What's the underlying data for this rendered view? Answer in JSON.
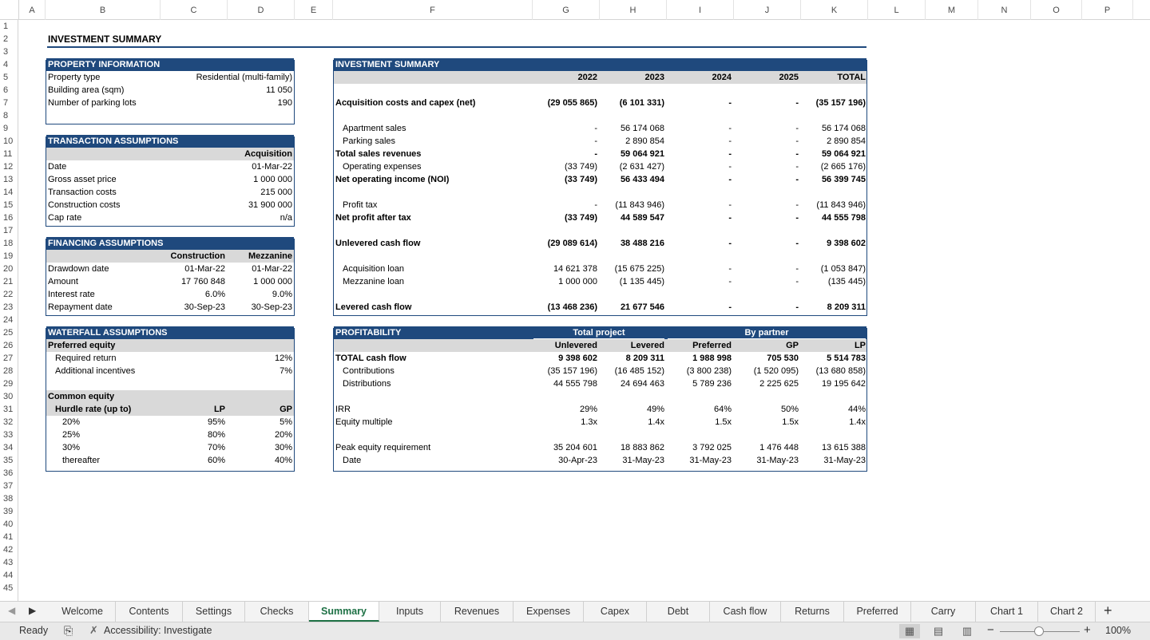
{
  "columns": [
    "A",
    "B",
    "C",
    "D",
    "E",
    "F",
    "G",
    "H",
    "I",
    "J",
    "K",
    "L",
    "M",
    "N",
    "O",
    "P"
  ],
  "rows": [
    "1",
    "2",
    "3",
    "4",
    "5",
    "6",
    "7",
    "8",
    "9",
    "10",
    "11",
    "12",
    "13",
    "14",
    "15",
    "16",
    "17",
    "18",
    "19",
    "20",
    "21",
    "22",
    "23",
    "24",
    "25",
    "26",
    "27",
    "28",
    "29",
    "30",
    "31",
    "32",
    "33",
    "34",
    "35",
    "36",
    "37",
    "38",
    "39",
    "40",
    "41",
    "42",
    "43",
    "44",
    "45"
  ],
  "title": "INVESTMENT SUMMARY",
  "property": {
    "header": "PROPERTY INFORMATION",
    "rows": [
      {
        "label": "Property type",
        "value": "Residential (multi-family)"
      },
      {
        "label": "Building area (sqm)",
        "value": "11 050"
      },
      {
        "label": "Number of parking lots",
        "value": "190"
      }
    ]
  },
  "transaction": {
    "header": "TRANSACTION ASSUMPTIONS",
    "col": "Acquisition",
    "rows": [
      {
        "label": "Date",
        "value": "01-Mar-22"
      },
      {
        "label": "Gross asset price",
        "value": "1 000 000"
      },
      {
        "label": "Transaction costs",
        "value": "215 000"
      },
      {
        "label": "Construction costs",
        "value": "31 900 000"
      },
      {
        "label": "Cap rate",
        "value": "n/a"
      }
    ]
  },
  "financing": {
    "header": "FINANCING ASSUMPTIONS",
    "cols": [
      "Construction",
      "Mezzanine"
    ],
    "rows": [
      {
        "label": "Drawdown date",
        "c": "01-Mar-22",
        "d": "01-Mar-22"
      },
      {
        "label": "Amount",
        "c": "17 760 848",
        "d": "1 000 000"
      },
      {
        "label": "Interest rate",
        "c": "6.0%",
        "d": "9.0%"
      },
      {
        "label": "Repayment date",
        "c": "30-Sep-23",
        "d": "30-Sep-23"
      }
    ]
  },
  "waterfall": {
    "header": "WATERFALL ASSUMPTIONS",
    "preferred_label": "Preferred equity",
    "required_return_label": "Required return",
    "required_return": "12%",
    "incentives_label": "Additional incentives",
    "incentives": "7%",
    "common_label": "Common equity",
    "hurdle_label": "Hurdle rate (up to)",
    "lp": "LP",
    "gp": "GP",
    "hurdles": [
      {
        "h": "20%",
        "lp": "95%",
        "gp": "5%"
      },
      {
        "h": "25%",
        "lp": "80%",
        "gp": "20%"
      },
      {
        "h": "30%",
        "lp": "70%",
        "gp": "30%"
      },
      {
        "h": "thereafter",
        "lp": "60%",
        "gp": "40%"
      }
    ]
  },
  "summary": {
    "header": "INVESTMENT SUMMARY",
    "years": [
      "2022",
      "2023",
      "2024",
      "2025",
      "TOTAL"
    ],
    "acq": {
      "label": "Acquisition costs and capex (net)",
      "v": [
        "(29 055 865)",
        "(6 101 331)",
        "-",
        "-",
        "(35 157 196)"
      ]
    },
    "apt": {
      "label": "Apartment sales",
      "v": [
        "-",
        "56 174 068",
        "-",
        "-",
        "56 174 068"
      ]
    },
    "park": {
      "label": "Parking sales",
      "v": [
        "-",
        "2 890 854",
        "-",
        "-",
        "2 890 854"
      ]
    },
    "tsr": {
      "label": "Total sales revenues",
      "v": [
        "-",
        "59 064 921",
        "-",
        "-",
        "59 064 921"
      ]
    },
    "opex": {
      "label": "Operating expenses",
      "v": [
        "(33 749)",
        "(2 631 427)",
        "-",
        "-",
        "(2 665 176)"
      ]
    },
    "noi": {
      "label": "Net operating income (NOI)",
      "v": [
        "(33 749)",
        "56 433 494",
        "-",
        "-",
        "56 399 745"
      ]
    },
    "tax": {
      "label": "Profit tax",
      "v": [
        "-",
        "(11 843 946)",
        "-",
        "-",
        "(11 843 946)"
      ]
    },
    "npat": {
      "label": "Net profit after tax",
      "v": [
        "(33 749)",
        "44 589 547",
        "-",
        "-",
        "44 555 798"
      ]
    },
    "ucf": {
      "label": "Unlevered cash flow",
      "v": [
        "(29 089 614)",
        "38 488 216",
        "-",
        "-",
        "9 398 602"
      ]
    },
    "aloan": {
      "label": "Acquisition loan",
      "v": [
        "14 621 378",
        "(15 675 225)",
        "-",
        "-",
        "(1 053 847)"
      ]
    },
    "mloan": {
      "label": "Mezzanine loan",
      "v": [
        "1 000 000",
        "(1 135 445)",
        "-",
        "-",
        "(135 445)"
      ]
    },
    "lcf": {
      "label": "Levered cash flow",
      "v": [
        "(13 468 236)",
        "21 677 546",
        "-",
        "-",
        "8 209 311"
      ]
    }
  },
  "profit": {
    "header": "PROFITABILITY",
    "group1": "Total project",
    "group2": "By partner",
    "cols": [
      "Unlevered",
      "Levered",
      "Preferred",
      "GP",
      "LP"
    ],
    "tcf": {
      "label": "TOTAL cash flow",
      "v": [
        "9 398 602",
        "8 209 311",
        "1 988 998",
        "705 530",
        "5 514 783"
      ]
    },
    "contrib": {
      "label": "Contributions",
      "v": [
        "(35 157 196)",
        "(16 485 152)",
        "(3 800 238)",
        "(1 520 095)",
        "(13 680 858)"
      ]
    },
    "dist": {
      "label": "Distributions",
      "v": [
        "44 555 798",
        "24 694 463",
        "5 789 236",
        "2 225 625",
        "19 195 642"
      ]
    },
    "irr": {
      "label": "IRR",
      "v": [
        "29%",
        "49%",
        "64%",
        "50%",
        "44%"
      ]
    },
    "em": {
      "label": "Equity multiple",
      "v": [
        "1.3x",
        "1.4x",
        "1.5x",
        "1.5x",
        "1.4x"
      ]
    },
    "peak": {
      "label": "Peak equity requirement",
      "v": [
        "35 204 601",
        "18 883 862",
        "3 792 025",
        "1 476 448",
        "13 615 388"
      ]
    },
    "date": {
      "label": "Date",
      "v": [
        "30-Apr-23",
        "31-May-23",
        "31-May-23",
        "31-May-23",
        "31-May-23"
      ]
    }
  },
  "tabs": [
    "Welcome",
    "Contents",
    "Settings",
    "Checks",
    "Summary",
    "Inputs",
    "Revenues",
    "Expenses",
    "Capex",
    "Debt",
    "Cash flow",
    "Returns",
    "Preferred",
    "Carry",
    "Chart 1",
    "Chart 2"
  ],
  "active_tab": "Summary",
  "status": {
    "ready": "Ready",
    "accessibility": "Accessibility: Investigate",
    "zoom": "100%"
  },
  "colors": {
    "header_blue": "#1f497d",
    "grey": "#d9d9d9",
    "active_tab": "#1e7145"
  }
}
